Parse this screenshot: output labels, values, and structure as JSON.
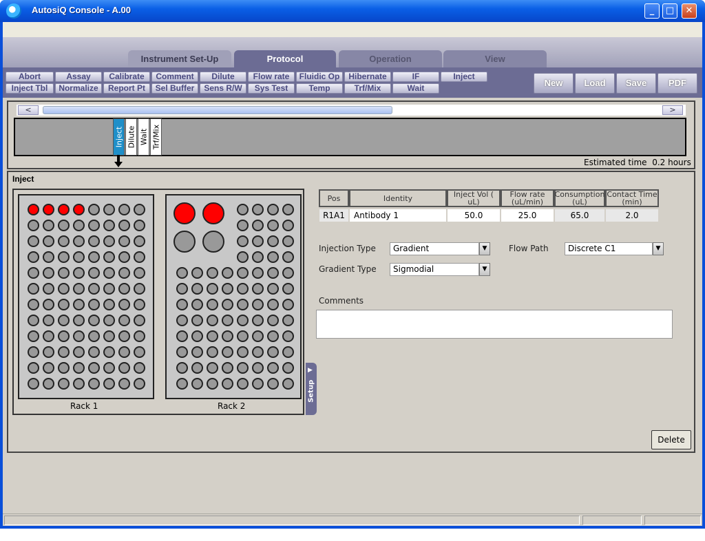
{
  "window": {
    "title": "AutosiQ Console - A.00"
  },
  "tabs": [
    {
      "label": "Instrument Set-Up"
    },
    {
      "label": "Protocol"
    },
    {
      "label": "Operation"
    },
    {
      "label": "View"
    }
  ],
  "toolbar_row1": [
    "Abort",
    "Assay",
    "Calibrate",
    "Comment",
    "Dilute",
    "Flow rate",
    "Fluidic Op",
    "Hibernate",
    "IF",
    "Inject"
  ],
  "toolbar_row2": [
    "Inject Tbl",
    "Normalize",
    "Report Pt",
    "Sel Buffer",
    "Sens R/W",
    "Sys Test",
    "Temp",
    "Trf/Mix",
    "Wait"
  ],
  "file_buttons": [
    "New",
    "Load",
    "Save",
    "PDF"
  ],
  "timeline": {
    "scroll_left": "<",
    "scroll_right": ">",
    "steps": [
      "Inject",
      "Dilute",
      "Wait",
      "Trf/Mix"
    ],
    "selected_step": "Inject",
    "estimated_label": "Estimated time",
    "estimated_value": "0.2 hours"
  },
  "section": {
    "title": "Inject"
  },
  "racks": [
    {
      "label": "Rack 1",
      "red_wells": [
        0,
        1,
        2,
        3
      ]
    },
    {
      "label": "Rack 2",
      "large_red": 2,
      "large_gray": 2
    }
  ],
  "setup_tab": "Setup",
  "table": {
    "headers": [
      "Pos",
      "Identity",
      "Inject Vol ( uL)",
      "Flow rate (uL/min)",
      "Consumption (uL)",
      "Contact Time (min)"
    ],
    "rows": [
      [
        "R1A1",
        "Antibody 1",
        "50.0",
        "25.0",
        "65.0",
        "2.0"
      ]
    ]
  },
  "fields": {
    "injection_type_label": "Injection Type",
    "injection_type_value": "Gradient",
    "flow_path_label": "Flow Path",
    "flow_path_value": "Discrete C1",
    "gradient_type_label": "Gradient Type",
    "gradient_type_value": "Sigmodial",
    "comments_label": "Comments",
    "comments_value": ""
  },
  "delete_button": "Delete",
  "colors": {
    "accent": "#6c6c94",
    "selected_step": "#1f8fc9",
    "sample_well": "#ff0000",
    "empty_well": "#999999"
  }
}
